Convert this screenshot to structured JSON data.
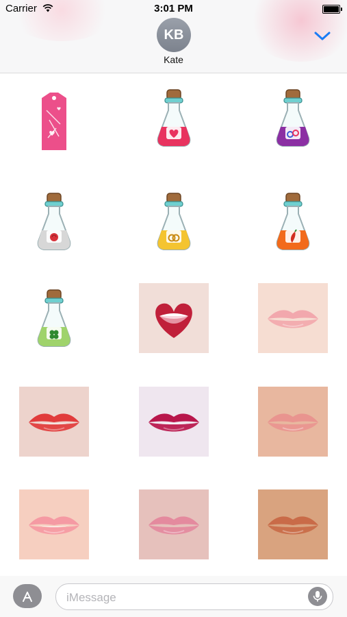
{
  "status_bar": {
    "carrier": "Carrier",
    "time": "3:01 PM"
  },
  "header": {
    "avatar_initials": "KB",
    "contact_name": "Kate"
  },
  "stickers": [
    {
      "name": "sticker-gift-tag",
      "kind": "tag"
    },
    {
      "name": "sticker-potion-heart",
      "kind": "potion",
      "liquid": "#e8335f",
      "symbol": "heart"
    },
    {
      "name": "sticker-potion-gender",
      "kind": "potion",
      "liquid": "#8b2fa3",
      "symbol": "gender"
    },
    {
      "name": "sticker-potion-rose",
      "kind": "potion",
      "liquid": "#d7d7d7",
      "symbol": "rose"
    },
    {
      "name": "sticker-potion-rings",
      "kind": "potion",
      "liquid": "#f4c430",
      "symbol": "rings"
    },
    {
      "name": "sticker-potion-pepper",
      "kind": "potion",
      "liquid": "#f26a1b",
      "symbol": "pepper"
    },
    {
      "name": "sticker-potion-clover",
      "kind": "potion",
      "liquid": "#9fd36b",
      "symbol": "clover"
    },
    {
      "name": "sticker-lips-heart",
      "kind": "lips",
      "bg": "#f1ded8",
      "lip": "#c0203a",
      "teeth": true,
      "heart": true
    },
    {
      "name": "sticker-lips-nude-pink",
      "kind": "lips",
      "bg": "#f6ddd2",
      "lip": "#f2a8ad",
      "teeth": false
    },
    {
      "name": "sticker-lips-red-smile",
      "kind": "lips",
      "bg": "#edd3cc",
      "lip": "#e13b3b",
      "teeth": true
    },
    {
      "name": "sticker-lips-bite",
      "kind": "lips",
      "bg": "#efe6ef",
      "lip": "#b8164b",
      "teeth": true
    },
    {
      "name": "sticker-lips-soft-nude",
      "kind": "lips",
      "bg": "#e8b79f",
      "lip": "#e9948f",
      "teeth": false
    },
    {
      "name": "sticker-lips-pink-open",
      "kind": "lips",
      "bg": "#f6cfc0",
      "lip": "#f59aa3",
      "teeth": true
    },
    {
      "name": "sticker-lips-mauve",
      "kind": "lips",
      "bg": "#e6c1bc",
      "lip": "#e48a9e",
      "teeth": false
    },
    {
      "name": "sticker-lips-bronze",
      "kind": "lips",
      "bg": "#d9a37f",
      "lip": "#c96b48",
      "teeth": false
    }
  ],
  "input_bar": {
    "placeholder": "iMessage"
  },
  "colors": {
    "accent": "#1a7cf5",
    "avatar": "#8a909a"
  }
}
